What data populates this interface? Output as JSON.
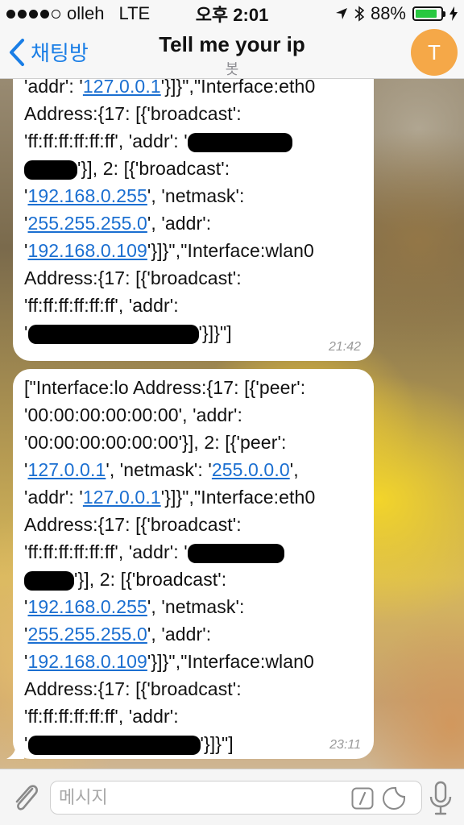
{
  "status_bar": {
    "carrier": "olleh",
    "network": "LTE",
    "time": "오후 2:01",
    "battery": "88%",
    "battery_level": 0.88
  },
  "nav": {
    "back_label": "채팅방",
    "title": "Tell me your ip",
    "subtitle": "봇",
    "avatar_letter": "T",
    "avatar_color": "#f5a848"
  },
  "messages": [
    {
      "time": "21:42",
      "segments": {
        "l1a": "'addr': '",
        "l1b": "127.0.0.1",
        "l1c": "'}]}\",\"Interface:eth0",
        "l2": "Address:{17: [{'broadcast':",
        "l3": "'ff:ff:ff:ff:ff:ff', 'addr': '",
        "l4b": "'}], 2: [{'broadcast':",
        "l5a": "'",
        "l5b": "192.168.0.255",
        "l5c": "', 'netmask':",
        "l6a": "'",
        "l6b": "255.255.255.0",
        "l6c": "', 'addr':",
        "l7a": "'",
        "l7b": "192.168.0.109",
        "l7c": "'}]}\",\"Interface:wlan0",
        "l8": "Address:{17: [{'broadcast':",
        "l9": "'ff:ff:ff:ff:ff:ff', 'addr':",
        "l10a": "'",
        "l10c": "'}]}\"]"
      }
    },
    {
      "time": "23:11",
      "segments": {
        "l1": "[\"Interface:lo Address:{17: [{'peer':",
        "l2": "'00:00:00:00:00:00', 'addr':",
        "l3": "'00:00:00:00:00:00'}], 2: [{'peer':",
        "l4a": "'",
        "l4b": "127.0.0.1",
        "l4c": "', 'netmask': '",
        "l4d": "255.0.0.0",
        "l4e": "',",
        "l5a": "'addr': '",
        "l5b": "127.0.0.1",
        "l5c": "'}]}\",\"Interface:eth0",
        "l6": "Address:{17: [{'broadcast':",
        "l7": "'ff:ff:ff:ff:ff:ff', 'addr': '",
        "l8b": "'}], 2: [{'broadcast':",
        "l9a": "'",
        "l9b": "192.168.0.255",
        "l9c": "', 'netmask':",
        "l10a": "'",
        "l10b": "255.255.255.0",
        "l10c": "', 'addr':",
        "l11a": "'",
        "l11b": "192.168.0.109",
        "l11c": "'}]}\",\"Interface:wlan0",
        "l12": "Address:{17: [{'broadcast':",
        "l13": "'ff:ff:ff:ff:ff:ff', 'addr':",
        "l14a": "'",
        "l14c": "'}]}\"]"
      }
    }
  ],
  "input": {
    "placeholder": "메시지"
  },
  "colors": {
    "accent": "#1a7ee6",
    "link": "#1b6fd1",
    "battery_green": "#28c840"
  }
}
